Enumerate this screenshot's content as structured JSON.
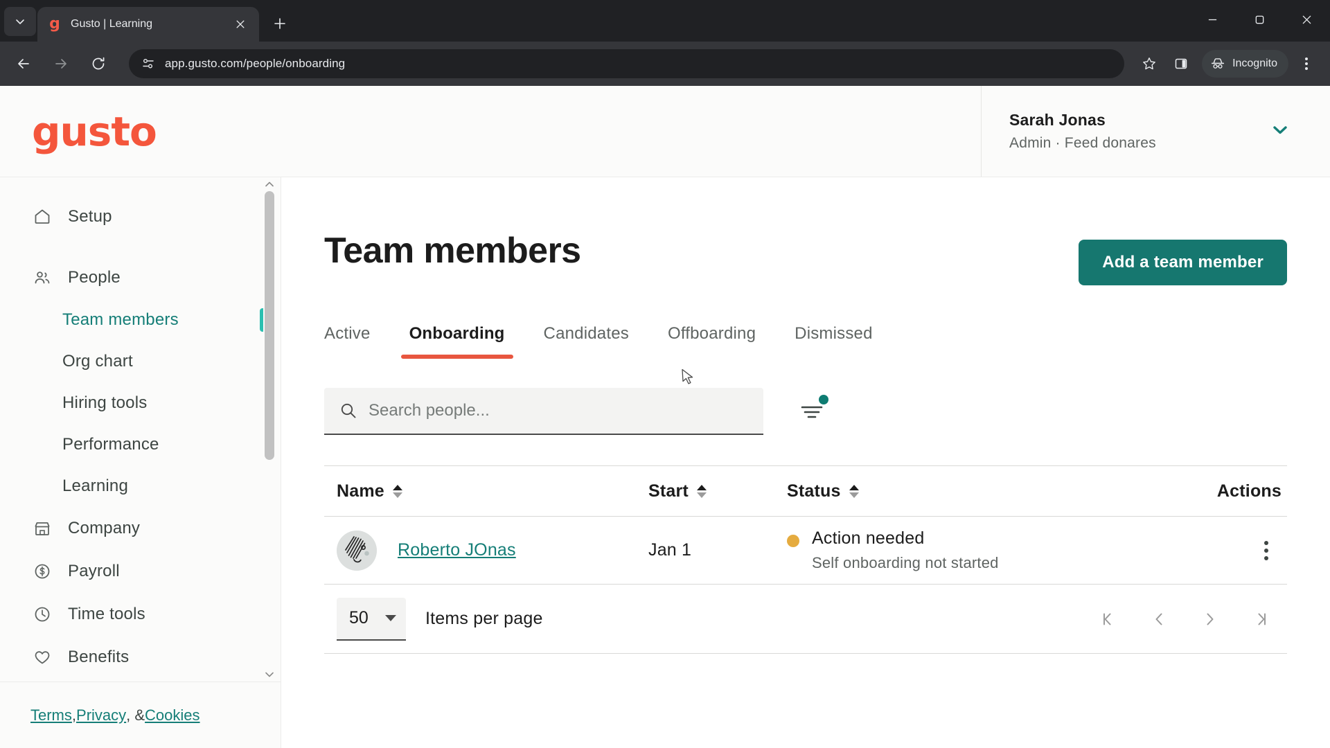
{
  "browser": {
    "tab": {
      "title": "Gusto | Learning",
      "favicon_letter": "g"
    },
    "tab_list_icon": "chevron-down-icon",
    "new_tab_icon": "plus-icon",
    "close_tab_icon": "close-icon",
    "window": {
      "minimize": "minimize-icon",
      "maximize": "maximize-icon",
      "close": "close-icon"
    },
    "nav": {
      "back": "back-arrow-icon",
      "forward": "forward-arrow-icon",
      "reload": "reload-icon"
    },
    "omnibox": {
      "url": "app.gusto.com/people/onboarding",
      "site_info_icon": "site-settings-icon"
    },
    "actions": {
      "bookmark_icon": "star-icon",
      "side_panel_icon": "side-panel-icon",
      "incognito_label": "Incognito",
      "incognito_icon": "incognito-icon",
      "menu_icon": "three-dot-menu-icon"
    }
  },
  "app_header": {
    "logo_text": "gusto",
    "user": {
      "name": "Sarah Jonas",
      "role": "Admin · Feed donares",
      "caret_icon": "chevron-down-icon"
    }
  },
  "sidebar": {
    "items": [
      {
        "label": "Setup",
        "icon": "home-icon",
        "type": "top",
        "active": false
      },
      {
        "label": "People",
        "icon": "people-icon",
        "type": "top",
        "active": false
      },
      {
        "label": "Team members",
        "icon": "",
        "type": "sub",
        "active": true
      },
      {
        "label": "Org chart",
        "icon": "",
        "type": "sub",
        "active": false
      },
      {
        "label": "Hiring tools",
        "icon": "",
        "type": "sub",
        "active": false
      },
      {
        "label": "Performance",
        "icon": "",
        "type": "sub",
        "active": false
      },
      {
        "label": "Learning",
        "icon": "",
        "type": "sub",
        "active": false
      },
      {
        "label": "Company",
        "icon": "store-icon",
        "type": "top",
        "active": false
      },
      {
        "label": "Payroll",
        "icon": "dollar-circle-icon",
        "type": "top",
        "active": false
      },
      {
        "label": "Time tools",
        "icon": "clock-icon",
        "type": "top",
        "active": false
      },
      {
        "label": "Benefits",
        "icon": "heart-icon",
        "type": "top",
        "active": false
      }
    ],
    "footer": {
      "terms": "Terms",
      "sep1": ", ",
      "privacy": "Privacy",
      "sep2": ", & ",
      "cookies": "Cookies"
    },
    "scrollbar": {
      "up_arrow_icon": "scroll-up-arrow-icon",
      "down_arrow_icon": "scroll-down-arrow-icon"
    }
  },
  "main": {
    "title": "Team members",
    "primary_button": "Add a team member",
    "tabs": [
      {
        "label": "Active",
        "active": false
      },
      {
        "label": "Onboarding",
        "active": true
      },
      {
        "label": "Candidates",
        "active": false
      },
      {
        "label": "Offboarding",
        "active": false
      },
      {
        "label": "Dismissed",
        "active": false
      }
    ],
    "search": {
      "placeholder": "Search people...",
      "value": "",
      "icon": "search-icon"
    },
    "filter": {
      "icon": "filter-icon",
      "has_badge": true
    },
    "table": {
      "columns": [
        {
          "label": "Name",
          "sortable": true
        },
        {
          "label": "Start",
          "sortable": true
        },
        {
          "label": "Status",
          "sortable": true
        },
        {
          "label": "Actions",
          "sortable": false
        }
      ],
      "rows": [
        {
          "name": "Roberto JOnas",
          "start": "Jan 1",
          "status_main": "Action needed",
          "status_sub": "Self onboarding not started",
          "status_color": "#e5ab3f",
          "avatar": "person-avatar",
          "actions_icon": "kebab-menu-icon"
        }
      ]
    },
    "pagination": {
      "per_page_value": "50",
      "per_page_label": "Items per page",
      "first_icon": "first-page-icon",
      "prev_icon": "previous-page-icon",
      "next_icon": "next-page-icon",
      "last_icon": "last-page-icon"
    }
  },
  "colors": {
    "brand": "#f4563c",
    "accent_teal": "#16776f",
    "active_tab_underline": "#e8563f",
    "status_warning": "#e5ab3f",
    "sidebar_active": "#2bbfb0"
  }
}
